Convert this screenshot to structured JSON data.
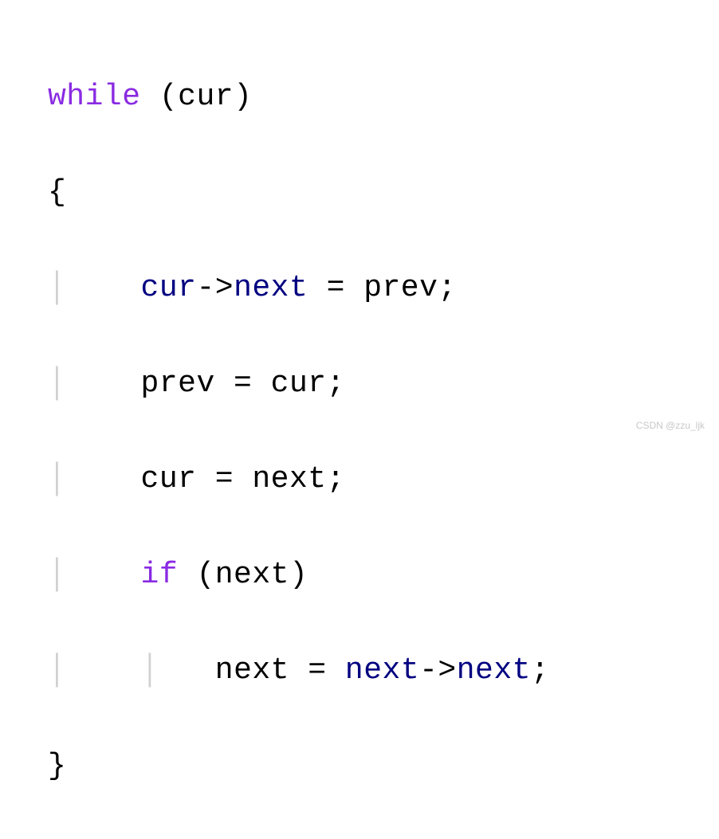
{
  "code": {
    "line1": {
      "keyword": "while",
      "paren_open": " (",
      "cond": "cur",
      "paren_close": ")"
    },
    "line2": {
      "text": "{"
    },
    "line3": {
      "guide": "│",
      "indent": "    ",
      "var1": "cur",
      "arrow": "->",
      "member": "next",
      "rest": " = prev;"
    },
    "line4": {
      "guide": "│",
      "indent": "    ",
      "text": "prev = cur;"
    },
    "line5": {
      "guide": "│",
      "indent": "    ",
      "text": "cur = next;"
    },
    "line6": {
      "guide": "│",
      "indent": "    ",
      "keyword": "if",
      "rest": " (next)"
    },
    "line7": {
      "guide1": "│",
      "indent1": "    ",
      "guide2": "│",
      "indent2": "   ",
      "pre": "next = ",
      "var1": "next",
      "arrow": "->",
      "member": "next",
      "semi": ";"
    },
    "line8": {
      "text": "}"
    }
  },
  "watermark": "CSDN @zzu_ljk"
}
